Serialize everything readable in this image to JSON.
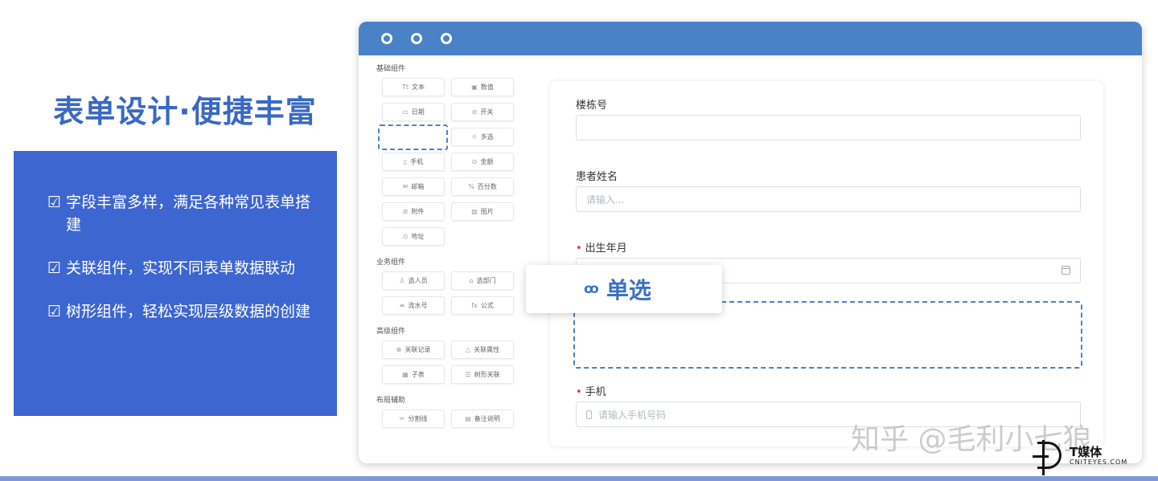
{
  "headline": "表单设计·便捷丰富",
  "features": [
    {
      "icon": "☑",
      "text": "字段丰富多样，满足各种常见表单搭建"
    },
    {
      "icon": "☑",
      "text": "关联组件，实现不同表单数据联动"
    },
    {
      "icon": "☑",
      "text": "树形组件，轻松实现层级数据的创建"
    }
  ],
  "palette": {
    "sections": [
      {
        "label": "基础组件",
        "items": [
          {
            "icon": "Tt",
            "label": "文本"
          },
          {
            "icon": "▣",
            "label": "数值"
          },
          {
            "icon": "▭",
            "label": "日期"
          },
          {
            "icon": "⊘",
            "label": "开关"
          },
          {
            "icon": "",
            "label": ""
          },
          {
            "icon": "☼",
            "label": "多选"
          },
          {
            "icon": "▯",
            "label": "手机"
          },
          {
            "icon": "⊙",
            "label": "金额"
          },
          {
            "icon": "✉",
            "label": "邮箱"
          },
          {
            "icon": "%",
            "label": "百分数"
          },
          {
            "icon": "⊘",
            "label": "附件"
          },
          {
            "icon": "▨",
            "label": "图片"
          },
          {
            "icon": "⊙",
            "label": "地址"
          }
        ]
      },
      {
        "label": "业务组件",
        "items": [
          {
            "icon": "♙",
            "label": "选人员"
          },
          {
            "icon": "⌂",
            "label": "选部门"
          },
          {
            "icon": "≡",
            "label": "流水号"
          },
          {
            "icon": "fx",
            "label": "公式"
          }
        ]
      },
      {
        "label": "高级组件",
        "items": [
          {
            "icon": "⊗",
            "label": "关联记录"
          },
          {
            "icon": "△",
            "label": "关联属性"
          },
          {
            "icon": "▦",
            "label": "子表"
          },
          {
            "icon": "☰",
            "label": "树形关联"
          }
        ]
      },
      {
        "label": "布局辅助",
        "items": [
          {
            "icon": "✂",
            "label": "分割线"
          },
          {
            "icon": "▤",
            "label": "备注说明"
          }
        ]
      }
    ]
  },
  "form": {
    "building": {
      "label": "楼栋号",
      "value": ""
    },
    "patient_name": {
      "label": "患者姓名",
      "placeholder": "请输入..."
    },
    "birth": {
      "label": "出生年月",
      "required_mark": "•"
    },
    "phone": {
      "label": "手机",
      "required_mark": "•",
      "placeholder": "请输入手机号码"
    }
  },
  "drag_item": {
    "icon": "ꝏ",
    "label": "单选"
  },
  "watermark": "知乎 @毛利小七狼",
  "logo": {
    "cn": "T媒体",
    "en": "CNITEYES.COM"
  },
  "colors": {
    "accent": "#4a82c8",
    "panel": "#3e66d0",
    "required": "#e53935"
  }
}
